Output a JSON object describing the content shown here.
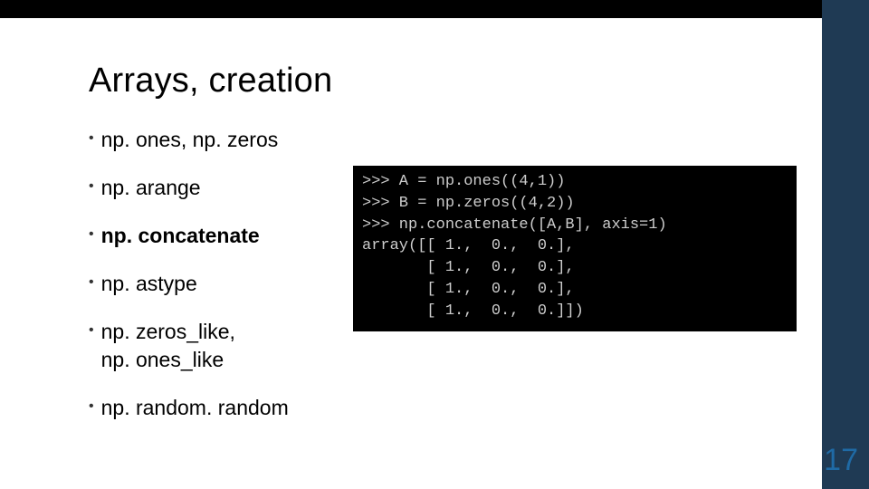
{
  "title": "Arrays, creation",
  "bullets": [
    {
      "text": "np. ones, np. zeros",
      "bold": false
    },
    {
      "text": "np. arange",
      "bold": false
    },
    {
      "text": "np. concatenate",
      "bold": true
    },
    {
      "text": "np. astype",
      "bold": false
    },
    {
      "text": "np. zeros_like,\nnp. ones_like",
      "bold": false
    },
    {
      "text": "np. random. random",
      "bold": false
    }
  ],
  "code": {
    "line1": ">>> A = np.ones((4,1))",
    "line2": ">>> B = np.zeros((4,2))",
    "line3": ">>> np.concatenate([A,B], axis=1)",
    "line4": "array([[ 1.,  0.,  0.],",
    "line5": "       [ 1.,  0.,  0.],",
    "line6": "       [ 1.,  0.,  0.],",
    "line7": "       [ 1.,  0.,  0.]])"
  },
  "page_number": "17"
}
